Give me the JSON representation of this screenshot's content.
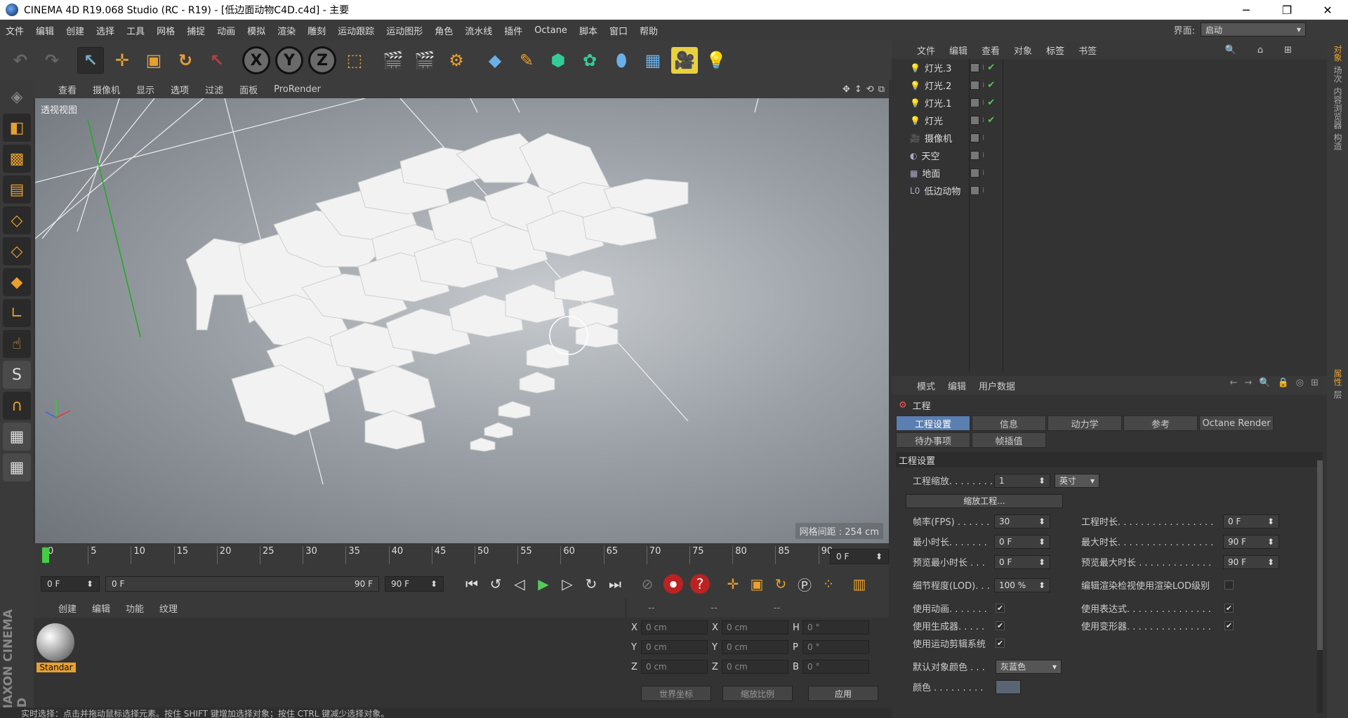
{
  "title": "CINEMA 4D R19.068 Studio (RC - R19) - [低边面动物C4D.c4d] - 主要",
  "window_controls": [
    "─",
    "❐",
    "✕"
  ],
  "menu": [
    "文件",
    "编辑",
    "创建",
    "选择",
    "工具",
    "网格",
    "捕捉",
    "动画",
    "模拟",
    "渲染",
    "雕刻",
    "运动跟踪",
    "运动图形",
    "角色",
    "流水线",
    "插件",
    "Octane",
    "脚本",
    "窗口",
    "帮助"
  ],
  "interface": {
    "label": "界面:",
    "value": "启动"
  },
  "toolbar": {
    "axis_x": "X",
    "axis_y": "Y",
    "axis_z": "Z"
  },
  "viewport": {
    "menu": [
      "查看",
      "摄像机",
      "显示",
      "选项",
      "过滤",
      "面板",
      "ProRender"
    ],
    "label": "透视视图",
    "grid_info": "网格间距 : 254 cm"
  },
  "timeline": {
    "ticks": [
      "0",
      "5",
      "10",
      "15",
      "20",
      "25",
      "30",
      "35",
      "40",
      "45",
      "50",
      "55",
      "60",
      "65",
      "70",
      "75",
      "80",
      "85",
      "90"
    ],
    "current_frame": "0 F"
  },
  "transport": {
    "start": "0 F",
    "range_start": "0 F",
    "range_end": "90 F",
    "end": "90 F"
  },
  "material_panel": {
    "menu": [
      "创建",
      "编辑",
      "功能",
      "纹理"
    ],
    "material_name": "Standar"
  },
  "coords": {
    "headers": [
      "--",
      "--",
      "--"
    ],
    "rows": [
      {
        "a": "X",
        "av": "0 cm",
        "b": "X",
        "bv": "0 cm",
        "c": "H",
        "cv": "0 °"
      },
      {
        "a": "Y",
        "av": "0 cm",
        "b": "Y",
        "bv": "0 cm",
        "c": "P",
        "cv": "0 °"
      },
      {
        "a": "Z",
        "av": "0 cm",
        "b": "Z",
        "bv": "0 cm",
        "c": "B",
        "cv": "0 °"
      }
    ],
    "world": "世界坐标",
    "scale": "缩放比例",
    "apply": "应用"
  },
  "status": "实时选择：点击并拖动鼠标选择元素。按住 SHIFT 键增加选择对象；按住 CTRL 键减少选择对象。",
  "object_manager": {
    "menu": [
      "文件",
      "编辑",
      "查看",
      "对象",
      "标签",
      "书签"
    ],
    "objects": [
      {
        "name": "灯光.3",
        "icon": "light-icon",
        "check": true
      },
      {
        "name": "灯光.2",
        "icon": "light-icon",
        "check": true
      },
      {
        "name": "灯光.1",
        "icon": "light-icon",
        "check": true
      },
      {
        "name": "灯光",
        "icon": "light-icon",
        "check": true
      },
      {
        "name": "摄像机",
        "icon": "camera-icon",
        "check": false
      },
      {
        "name": "天空",
        "icon": "sky-icon",
        "check": false
      },
      {
        "name": "地面",
        "icon": "floor-icon",
        "check": false
      },
      {
        "name": "低边动物",
        "icon": "null-icon",
        "check": false
      }
    ]
  },
  "right_tabs": [
    "对象",
    "场次",
    "内容浏览器",
    "构造"
  ],
  "right_tabs2": [
    "属性",
    "层"
  ],
  "attributes": {
    "menu": [
      "模式",
      "编辑",
      "用户数据"
    ],
    "project": "工程",
    "tabs_row1": [
      "工程设置",
      "信息",
      "动力学",
      "参考",
      "Octane Render"
    ],
    "tabs_row2": [
      "待办事项",
      "帧插值"
    ],
    "section": "工程设置",
    "scale_label": "工程缩放. . . . . . . .",
    "scale_value": "1",
    "scale_unit": "英寸",
    "scale_button": "缩放工程...",
    "fps_label": "帧率(FPS) . . . . . .",
    "fps_value": "30",
    "duration_label": "工程时长. . . . . . . . . . . . . . . . .",
    "duration_value": "0 F",
    "min_label": "最小时长. . . . . . .",
    "min_value": "0 F",
    "max_label": "最大时长. . . . . . . . . . . . . . . . .",
    "max_value": "90 F",
    "pmin_label": "预览最小时长 . . .",
    "pmin_value": "0 F",
    "pmax_label": "预览最大时长 . . . . . . . . . . . . .",
    "pmax_value": "90 F",
    "lod_label": "细节程度(LOD). . .",
    "lod_value": "100 %",
    "lod_render_label": "编辑渲染检视使用渲染LOD级别",
    "anim_label": "使用动画. . . . . . .",
    "expr_label": "使用表达式. . . . . . . . . . . . . . .",
    "gen_label": "使用生成器. . . . .",
    "deform_label": "使用变形器. . . . . . . . . . . . . . .",
    "motion_label": "使用运动剪辑系统",
    "color_label": "默认对象颜色 . . .",
    "color_value": "灰蓝色",
    "color2_label": "颜色 . . . . . . . . ."
  }
}
